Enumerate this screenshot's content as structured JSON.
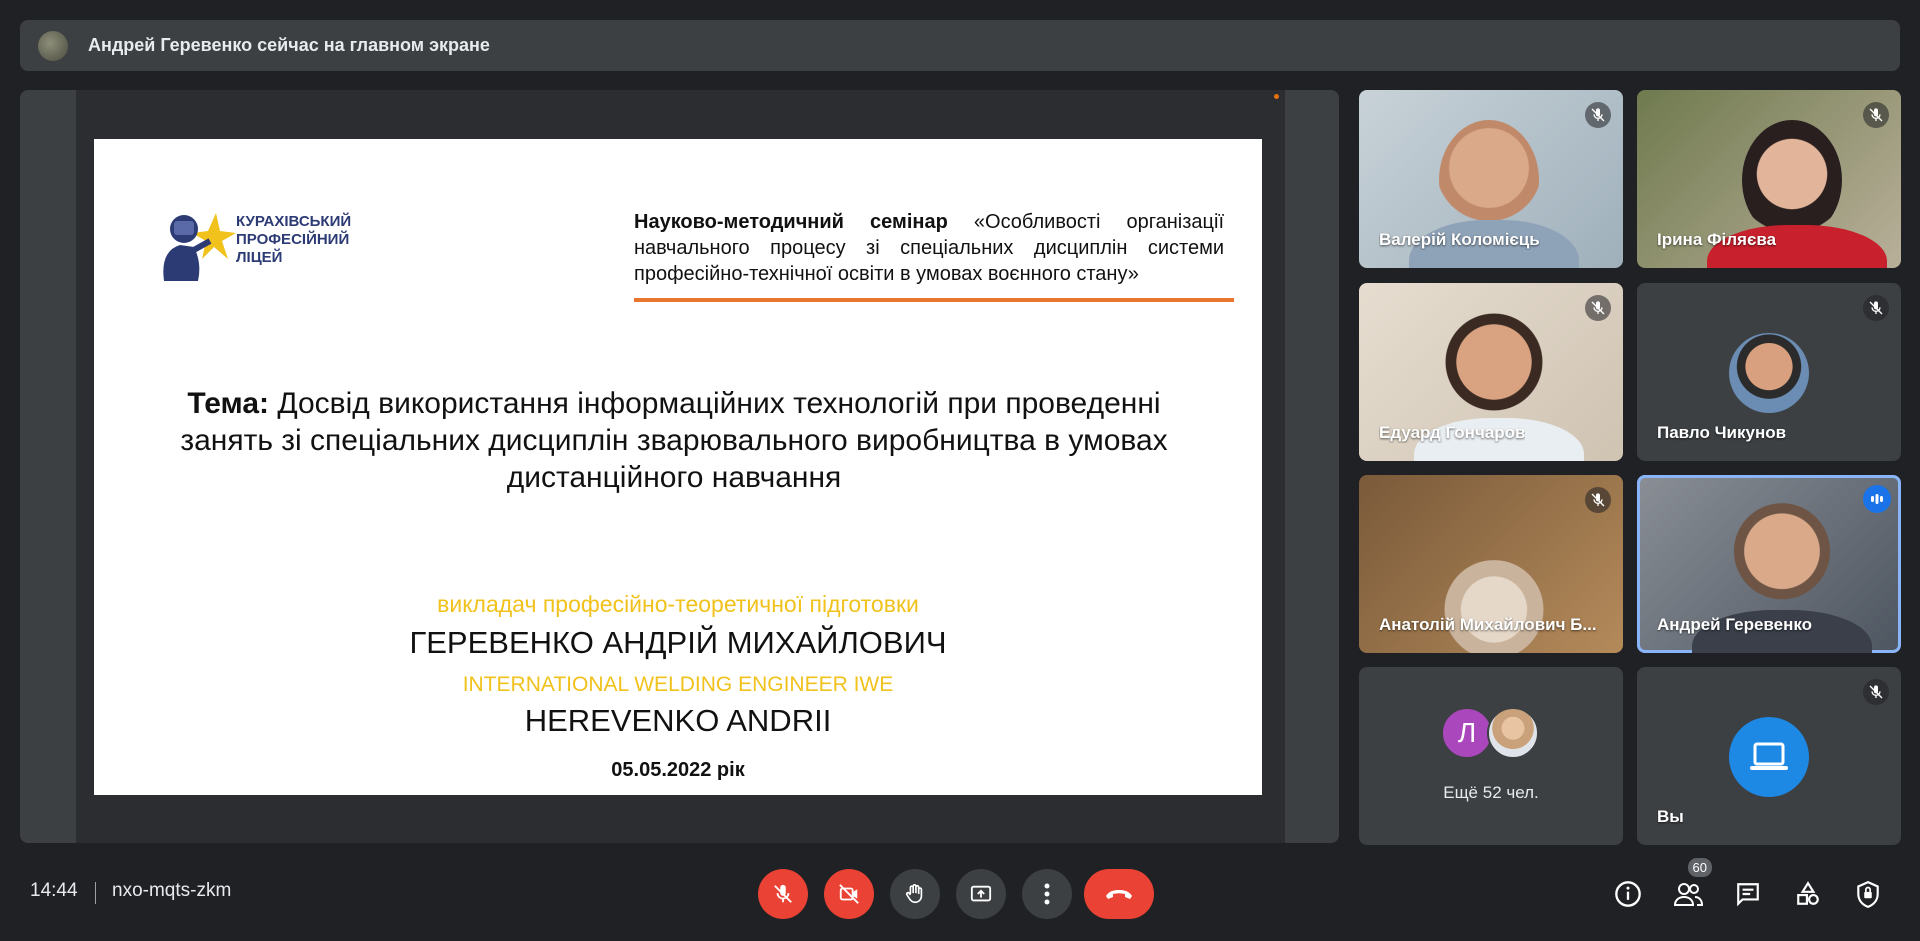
{
  "banner": {
    "text": "Андрей Геревенко сейчас на главном экране"
  },
  "slide": {
    "logo_lines": [
      "КУРАХІВСЬКИЙ",
      "ПРОФЕСІЙНИЙ",
      "ЛІЦЕЙ"
    ],
    "seminar_bold": "Науково-методичний семінар",
    "seminar_text": "«Особливості організації навчального процесу зі спеціальних дисциплін системи професійно-технічної освіти в умовах воєнного стану»",
    "topic_bold": "Тема:",
    "topic_text": "Досвід використання інформаційних технологій при проведенні занять зі спеціальних дисциплін зварювального виробництва в умовах дистанційного навчання",
    "role_ua": "викладач професійно-теоретичної підготовки",
    "name_ua": "ГЕРЕВЕНКО АНДРІЙ МИХАЙЛОВИЧ",
    "role_en": "INTERNATIONAL WELDING ENGINEER IWE",
    "name_en": "HEREVENKO ANDRII",
    "date": "05.05.2022 рік"
  },
  "participants": [
    {
      "name": "Валерій Коломієць",
      "muted": true
    },
    {
      "name": "Ірина Філяєва",
      "muted": true
    },
    {
      "name": "Едуард Гончаров",
      "muted": true
    },
    {
      "name": "Павло Чикунов",
      "muted": true
    },
    {
      "name": "Анатолій Михайлович Б...",
      "muted": true
    },
    {
      "name": "Андрей Геревенко",
      "speaking": true
    },
    {
      "more_initial": "Л",
      "more_label": "Ещё 52 чел."
    },
    {
      "name": "Вы",
      "muted": true
    }
  ],
  "footer": {
    "time": "14:44",
    "meeting_code": "nxo-mqts-zkm",
    "participants_count": "60"
  },
  "colors": {
    "end_call": "#ea4335",
    "accent": "#1a73e8",
    "slide_orange": "#e8762d",
    "slide_yellow": "#f1c21b"
  }
}
